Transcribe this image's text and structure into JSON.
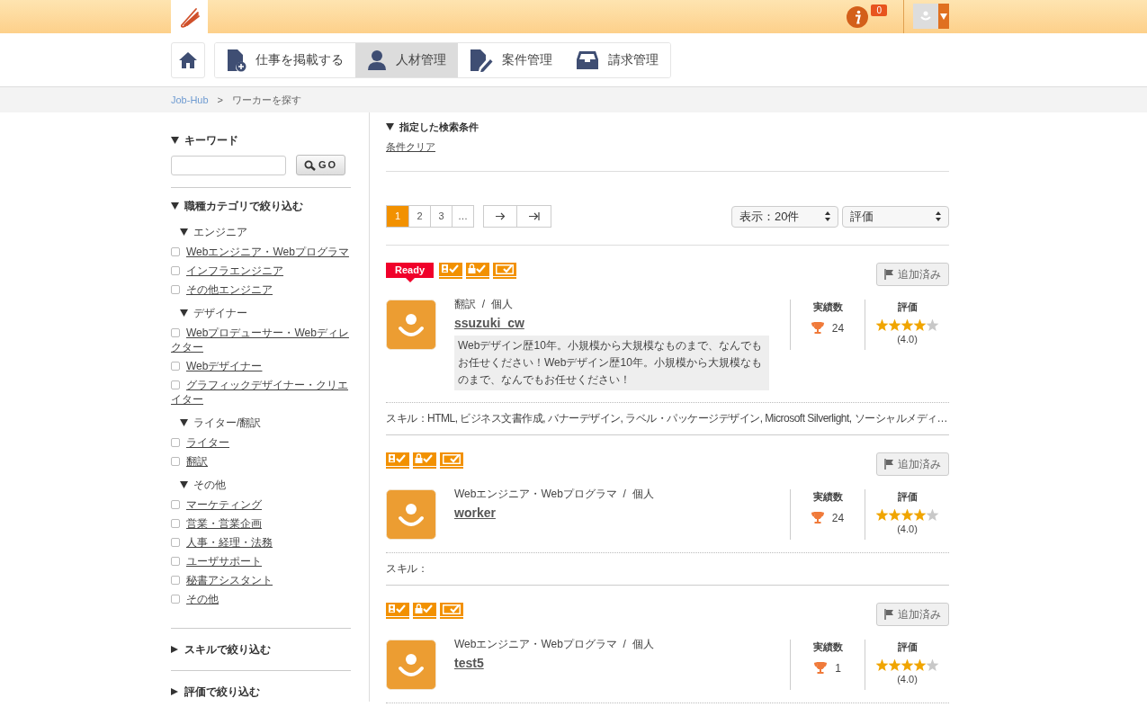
{
  "header": {
    "notification_count": "0"
  },
  "nav": {
    "tabs": [
      {
        "kind": "post",
        "label": "仕事を掲載する",
        "selected": false
      },
      {
        "kind": "people",
        "label": "人材管理",
        "selected": true
      },
      {
        "kind": "cases",
        "label": "案件管理",
        "selected": false
      },
      {
        "kind": "billing",
        "label": "請求管理",
        "selected": false
      }
    ]
  },
  "breadcrumb": [
    "Job-Hub",
    ">",
    "ワーカーを探す"
  ],
  "sidebar": {
    "keyword": {
      "title": "キーワード",
      "button": "GO"
    },
    "category_filter": {
      "title": "職種カテゴリで絞り込む",
      "groups": [
        {
          "title": "エンジニア",
          "items": [
            {
              "label": "Webエンジニア・Webプログラマ",
              "checked": false
            },
            {
              "label": "インフラエンジニア",
              "checked": false
            },
            {
              "label": "その他エンジニア",
              "checked": false
            }
          ]
        },
        {
          "title": "デザイナー",
          "items": [
            {
              "label": "Webプロデューサー・Webディレクター",
              "checked": false
            },
            {
              "label": "Webデザイナー",
              "checked": false
            },
            {
              "label": "グラフィックデザイナー・クリエイター",
              "checked": false
            }
          ]
        },
        {
          "title": "ライター/翻訳",
          "items": [
            {
              "label": "ライター",
              "checked": false
            },
            {
              "label": "翻訳",
              "checked": false
            }
          ]
        },
        {
          "title": "その他",
          "items": [
            {
              "label": "マーケティング",
              "checked": false
            },
            {
              "label": "営業・営業企画",
              "checked": false
            },
            {
              "label": "人事・経理・法務",
              "checked": false
            },
            {
              "label": "ユーザサポート",
              "checked": false
            },
            {
              "label": "秘書アシスタント",
              "checked": false
            },
            {
              "label": "その他",
              "checked": false
            }
          ]
        }
      ]
    },
    "collapsed_sections": [
      {
        "title": "スキルで絞り込む",
        "expanded": false
      },
      {
        "title": "評価で絞り込む",
        "expanded": false
      }
    ]
  },
  "search_conditions": {
    "title": "指定した検索条件",
    "clear_link": "条件クリア"
  },
  "pagination": {
    "pages": [
      {
        "label": "1",
        "selected": true
      },
      {
        "label": "2",
        "selected": false
      },
      {
        "label": "3",
        "selected": false
      },
      {
        "label": "…",
        "selected": false
      }
    ]
  },
  "per_page": "表示：20件",
  "sort": "評価",
  "workers": [
    {
      "status_badge": "Ready",
      "meta": "翻訳  /  個人",
      "name": "ssuzuki_cw",
      "bio": "Webデザイン歴10年。小規模から大規模なものまで、なんでもお任せください！Webデザイン歴10年。小規模から大規模なものまで、なんでもお任せください！",
      "saved_button": "追加済み",
      "achievements_label": "実績数",
      "achievements": "24",
      "rating_label": "評価",
      "stars": 4,
      "rating": "(4.0)",
      "skills": "スキル：HTML, ビジネス文書作成, バナーデザイン, ラベル・パッケージデザイン, Microsoft Silverlight, ソーシャルメディ…"
    },
    {
      "meta": "Webエンジニア・Webプログラマ  /  個人",
      "name": "worker",
      "saved_button": "追加済み",
      "achievements_label": "実績数",
      "achievements": "24",
      "rating_label": "評価",
      "stars": 4,
      "rating": "(4.0)",
      "skills": "スキル："
    },
    {
      "meta": "Webエンジニア・Webプログラマ  /  個人",
      "name": "test5",
      "saved_button": "追加済み",
      "achievements_label": "実績数",
      "achievements": "1",
      "rating_label": "評価",
      "stars": 4,
      "rating": "(4.0)"
    }
  ]
}
